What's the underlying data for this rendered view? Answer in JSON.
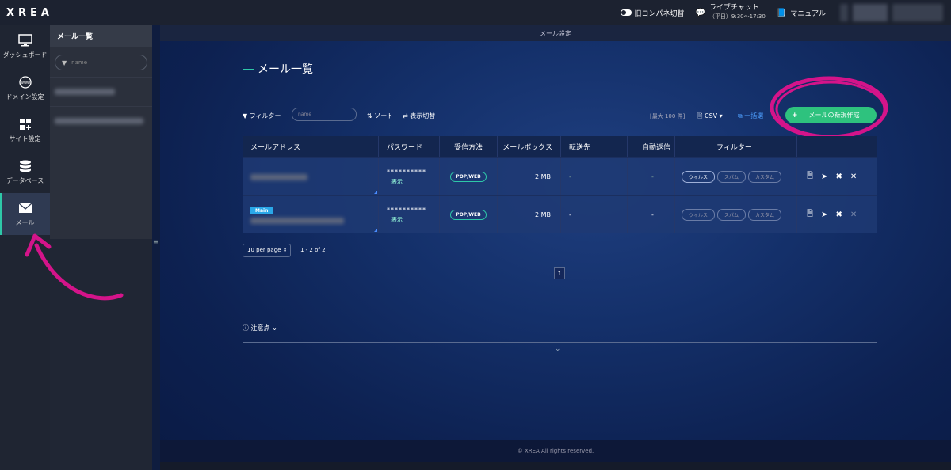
{
  "app": {
    "logo": "XREA"
  },
  "topbar": {
    "old_panel": "旧コンパネ切替",
    "chat_title": "ライブチャット",
    "chat_hours": "（平日）9:30〜17:30",
    "manual": "マニュアル"
  },
  "leftnav": [
    {
      "label": "ダッシュボード",
      "icon": "monitor-icon"
    },
    {
      "label": "ドメイン設定",
      "icon": "www-globe-icon"
    },
    {
      "label": "サイト設定",
      "icon": "grid-plus-icon"
    },
    {
      "label": "データベース",
      "icon": "database-icon"
    },
    {
      "label": "メール",
      "icon": "mail-icon",
      "active": true
    }
  ],
  "subnav": {
    "title": "メール一覧",
    "search_placeholder": "name"
  },
  "main": {
    "header": "メール設定",
    "title": "メール一覧",
    "toolbar": {
      "filter_label": "フィルター",
      "filter_placeholder": "name",
      "sort": "ソート",
      "view_toggle": "表示切替",
      "max_count": "[最大 100 件]",
      "csv": "CSV",
      "bulk": "一括選",
      "create": "メールの新規作成"
    },
    "table": {
      "headers": [
        "メールアドレス",
        "パスワード",
        "受信方法",
        "メールボックス",
        "転送先",
        "自動返信",
        "フィルター"
      ],
      "rows": [
        {
          "password": "**********",
          "show": "表示",
          "method": "POP/WEB",
          "mailbox": "2 MB",
          "forward": "-",
          "auto_reply": "-",
          "filters": [
            "ウィルス",
            "スパム",
            "カスタム"
          ],
          "badge": ""
        },
        {
          "password": "**********",
          "show": "表示",
          "method": "POP/WEB",
          "mailbox": "2 MB",
          "forward": "-",
          "auto_reply": "-",
          "filters": [
            "ウィルス",
            "スパム",
            "カスタム"
          ],
          "badge": "Main"
        }
      ]
    },
    "pagination": {
      "per_page": "10 per page",
      "range": "1 - 2 of 2",
      "page": "1"
    },
    "notes": "注意点",
    "footer": "© XREA All rights reserved."
  },
  "colors": {
    "accent": "#2ec27e",
    "annotation": "#d4148a",
    "main_bg": "#14306a"
  }
}
